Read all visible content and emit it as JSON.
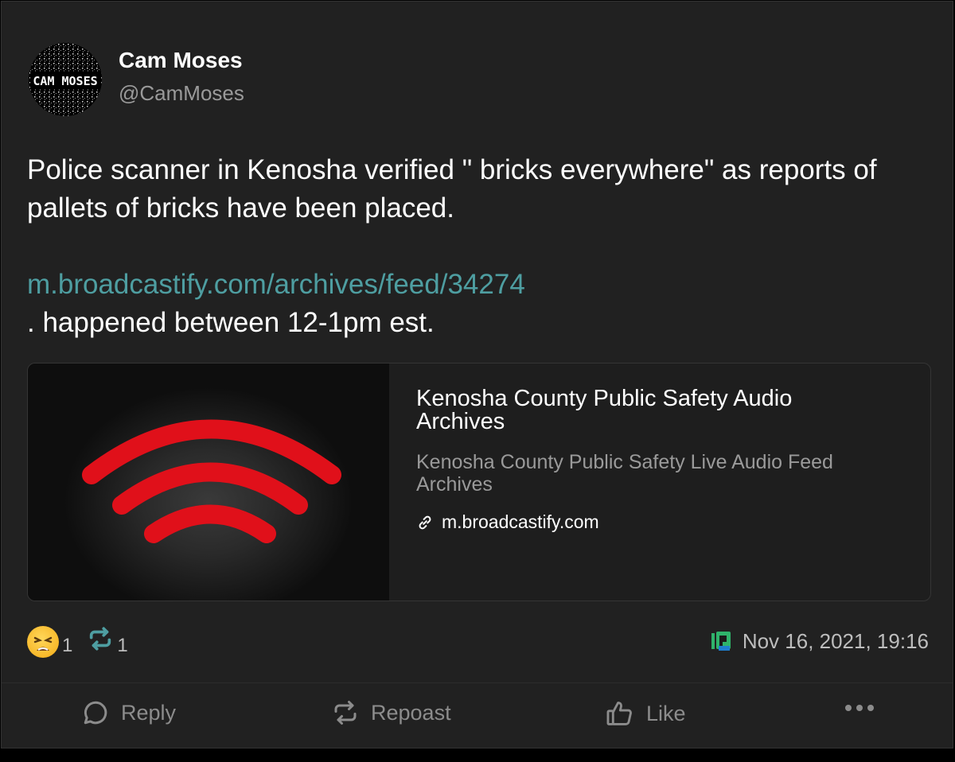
{
  "author": {
    "name": "Cam Moses",
    "handle": "@CamMoses",
    "avatar_text": "CAM MOSES"
  },
  "post": {
    "text_line1": "Police scanner in Kenosha verified \" bricks everywhere\" as reports of pallets of bricks have been placed.",
    "link_text": "m.broadcastify.com/archives/feed/34274",
    "text_line2": ". happened between 12-1pm est."
  },
  "card": {
    "title": "Kenosha County Public Safety Audio Archives",
    "description": "Kenosha County Public Safety Live Audio Feed Archives",
    "domain": "m.broadcastify.com",
    "thumb_icon": "radio-signal-icon",
    "thumb_color": "#e0101a"
  },
  "stats": {
    "reaction_emoji": "weary-face-icon",
    "reaction_count": "1",
    "repost_count": "1",
    "timestamp": "Nov 16, 2021, 19:16",
    "source_icon": "app-source-icon"
  },
  "actions": {
    "reply_label": "Reply",
    "repost_label": "Repoast",
    "like_label": "Like",
    "more_icon": "more-icon"
  },
  "colors": {
    "background": "#212121",
    "link": "#4e9ea1",
    "repost_accent": "#4e9ea1",
    "muted": "#8c8c8c"
  }
}
